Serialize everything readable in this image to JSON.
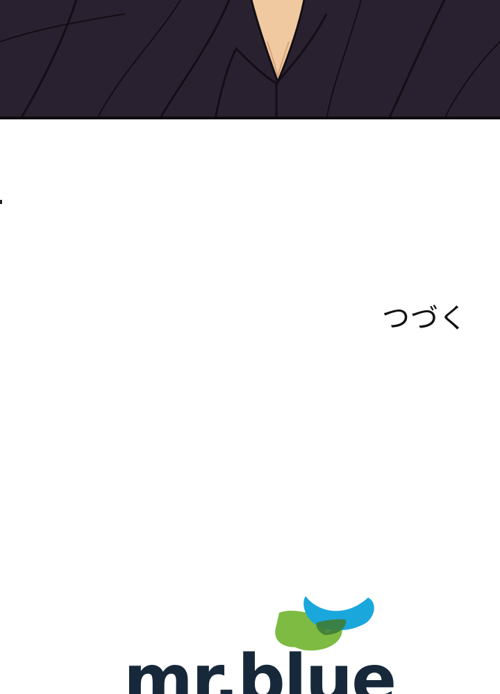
{
  "panel": {
    "description_icon": "dark-garment-illustration"
  },
  "ending": {
    "text": "つづく"
  },
  "logo": {
    "text": "mr.blue",
    "colors": {
      "green": "#7dbb42",
      "cyan": "#1aa7dc",
      "overlap": "#3e7d36",
      "text": "#16283a"
    }
  }
}
